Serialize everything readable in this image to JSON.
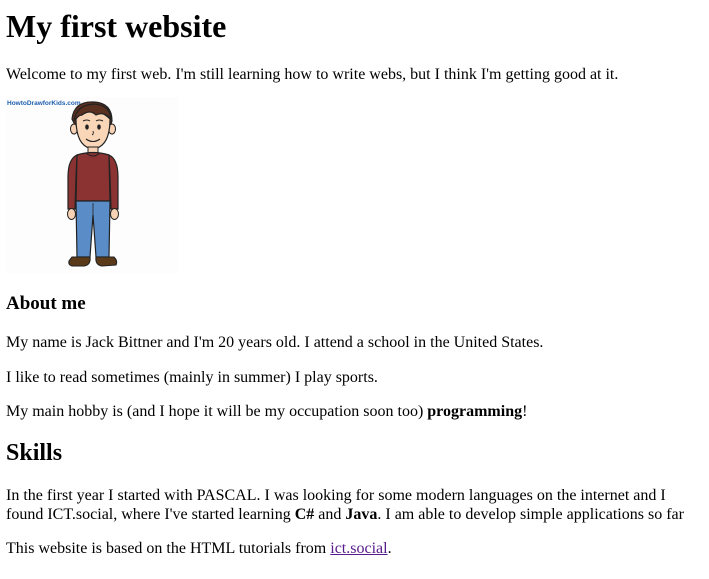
{
  "page": {
    "title": "My first website",
    "intro": "Welcome to my first web. I'm still learning how to write webs, but I think I'm getting good at it.",
    "image": {
      "watermark": "HowtoDrawforKids.com",
      "icon": "cartoon-boy"
    },
    "about": {
      "heading": "About me",
      "p1": "My name is Jack Bittner and I'm 20 years old. I attend a school in the United States.",
      "p2": "I like to read sometimes (mainly in summer) I play sports.",
      "p3_before": "My main hobby is (and I hope it will be my occupation soon too) ",
      "p3_bold": "programming",
      "p3_after": "!"
    },
    "skills": {
      "heading": "Skills",
      "line1": "In the first year I started with PASCAL. I was looking for some modern languages on the internet and I",
      "line2_before": "found ICT.social, where I've started learning ",
      "line2_bold1": "C#",
      "line2_mid": " and ",
      "line2_bold2": "Java",
      "line2_after": ". I am able to develop simple applications so far"
    },
    "footer": {
      "text": "This website is based on the HTML tutorials from ",
      "link_text": "ict.social",
      "after": "."
    },
    "colors": {
      "link_visited": "#551a8b",
      "shirt": "#8b3232",
      "pants": "#5a8cc8",
      "hair": "#5a3020",
      "shoes": "#5a3a18"
    }
  }
}
